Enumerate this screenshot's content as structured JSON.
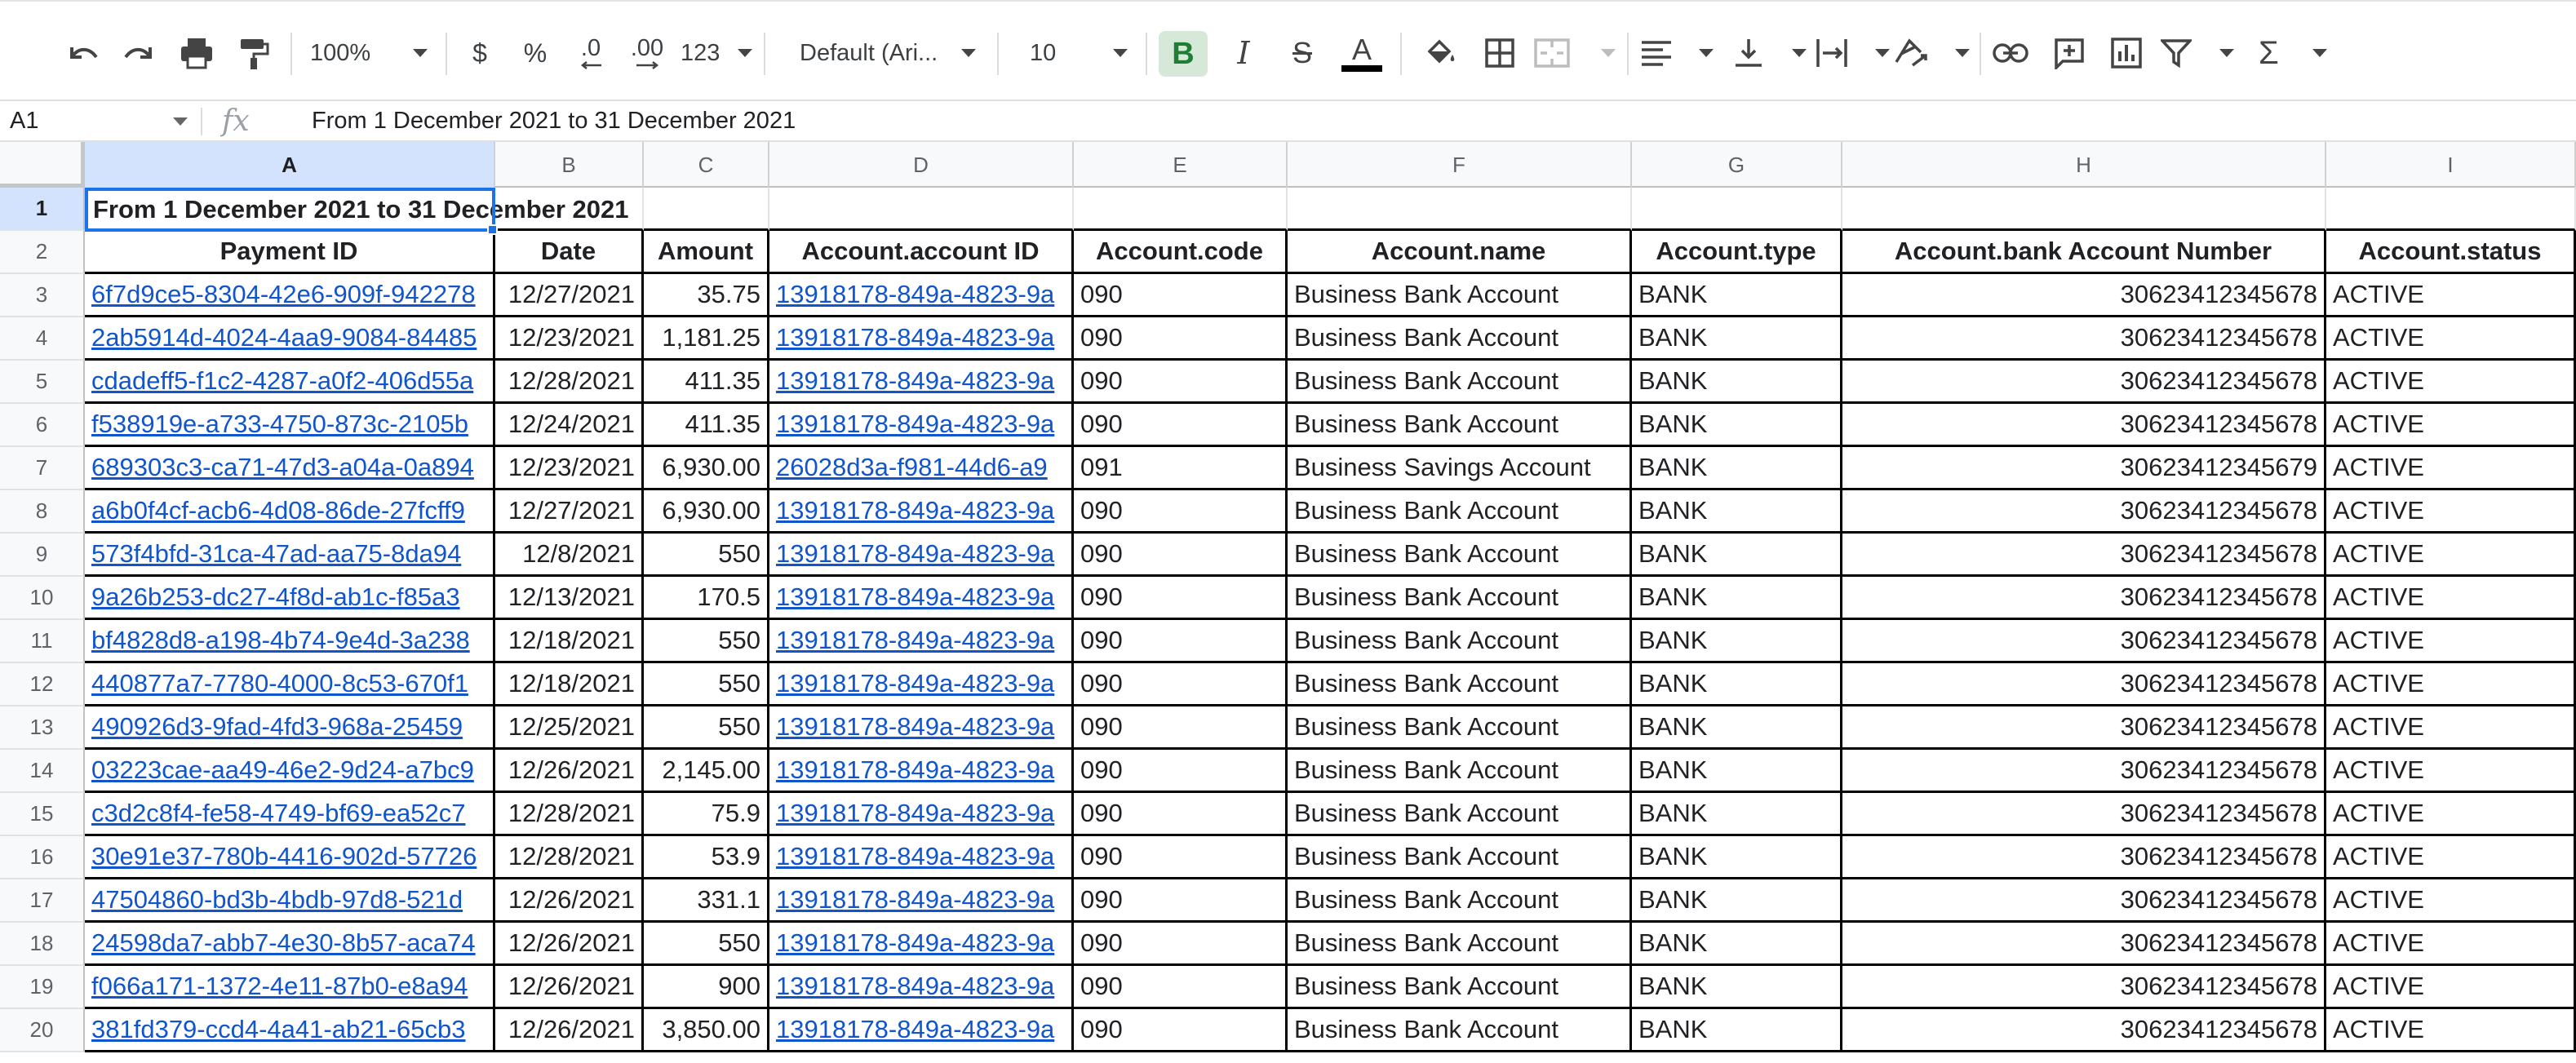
{
  "toolbar": {
    "zoom": "100%",
    "currency_symbol": "$",
    "percent_symbol": "%",
    "decrease_decimals": ".0",
    "increase_decimals": ".00",
    "more_formats": "123",
    "font": "Default (Ari...",
    "font_size": "10",
    "bold_label": "B",
    "italic_label": "I",
    "strike_label": "S",
    "text_color_label": "A",
    "accent_color": "#1a73e8",
    "link_color": "#1155cc",
    "bold_active_bg": "#d6e9d8"
  },
  "formula_bar": {
    "cell_ref": "A1",
    "fx_label": "fx",
    "content": "From 1 December 2021 to 31 December 2021"
  },
  "sheet": {
    "columns": [
      "A",
      "B",
      "C",
      "D",
      "E",
      "F",
      "G",
      "H",
      "I"
    ],
    "title": "From 1 December 2021 to 31 December 2021",
    "headers": [
      "Payment ID",
      "Date",
      "Amount",
      "Account.account ID",
      "Account.code",
      "Account.name",
      "Account.type",
      "Account.bank Account Number",
      "Account.status"
    ],
    "rows": [
      {
        "n": "3",
        "cells": [
          "6f7d9ce5-8304-42e6-909f-942278",
          "12/27/2021",
          "35.75",
          "13918178-849a-4823-9a",
          "090",
          "Business Bank Account",
          "BANK",
          "30623412345678",
          "ACTIVE"
        ]
      },
      {
        "n": "4",
        "cells": [
          "2ab5914d-4024-4aa9-9084-84485",
          "12/23/2021",
          "1,181.25",
          "13918178-849a-4823-9a",
          "090",
          "Business Bank Account",
          "BANK",
          "30623412345678",
          "ACTIVE"
        ]
      },
      {
        "n": "5",
        "cells": [
          "cdadeff5-f1c2-4287-a0f2-406d55a",
          "12/28/2021",
          "411.35",
          "13918178-849a-4823-9a",
          "090",
          "Business Bank Account",
          "BANK",
          "30623412345678",
          "ACTIVE"
        ]
      },
      {
        "n": "6",
        "cells": [
          "f538919e-a733-4750-873c-2105b",
          "12/24/2021",
          "411.35",
          "13918178-849a-4823-9a",
          "090",
          "Business Bank Account",
          "BANK",
          "30623412345678",
          "ACTIVE"
        ]
      },
      {
        "n": "7",
        "cells": [
          "689303c3-ca71-47d3-a04a-0a894",
          "12/23/2021",
          "6,930.00",
          "26028d3a-f981-44d6-a9",
          "091",
          "Business Savings Account",
          "BANK",
          "30623412345679",
          "ACTIVE"
        ]
      },
      {
        "n": "8",
        "cells": [
          "a6b0f4cf-acb6-4d08-86de-27fcff9",
          "12/27/2021",
          "6,930.00",
          "13918178-849a-4823-9a",
          "090",
          "Business Bank Account",
          "BANK",
          "30623412345678",
          "ACTIVE"
        ]
      },
      {
        "n": "9",
        "cells": [
          "573f4bfd-31ca-47ad-aa75-8da94",
          "12/8/2021",
          "550",
          "13918178-849a-4823-9a",
          "090",
          "Business Bank Account",
          "BANK",
          "30623412345678",
          "ACTIVE"
        ]
      },
      {
        "n": "10",
        "cells": [
          "9a26b253-dc27-4f8d-ab1c-f85a3",
          "12/13/2021",
          "170.5",
          "13918178-849a-4823-9a",
          "090",
          "Business Bank Account",
          "BANK",
          "30623412345678",
          "ACTIVE"
        ]
      },
      {
        "n": "11",
        "cells": [
          "bf4828d8-a198-4b74-9e4d-3a238",
          "12/18/2021",
          "550",
          "13918178-849a-4823-9a",
          "090",
          "Business Bank Account",
          "BANK",
          "30623412345678",
          "ACTIVE"
        ]
      },
      {
        "n": "12",
        "cells": [
          "440877a7-7780-4000-8c53-670f1",
          "12/18/2021",
          "550",
          "13918178-849a-4823-9a",
          "090",
          "Business Bank Account",
          "BANK",
          "30623412345678",
          "ACTIVE"
        ]
      },
      {
        "n": "13",
        "cells": [
          "490926d3-9fad-4fd3-968a-25459",
          "12/25/2021",
          "550",
          "13918178-849a-4823-9a",
          "090",
          "Business Bank Account",
          "BANK",
          "30623412345678",
          "ACTIVE"
        ]
      },
      {
        "n": "14",
        "cells": [
          "03223cae-aa49-46e2-9d24-a7bc9",
          "12/26/2021",
          "2,145.00",
          "13918178-849a-4823-9a",
          "090",
          "Business Bank Account",
          "BANK",
          "30623412345678",
          "ACTIVE"
        ]
      },
      {
        "n": "15",
        "cells": [
          "c3d2c8f4-fe58-4749-bf69-ea52c7",
          "12/28/2021",
          "75.9",
          "13918178-849a-4823-9a",
          "090",
          "Business Bank Account",
          "BANK",
          "30623412345678",
          "ACTIVE"
        ]
      },
      {
        "n": "16",
        "cells": [
          "30e91e37-780b-4416-902d-57726",
          "12/28/2021",
          "53.9",
          "13918178-849a-4823-9a",
          "090",
          "Business Bank Account",
          "BANK",
          "30623412345678",
          "ACTIVE"
        ]
      },
      {
        "n": "17",
        "cells": [
          "47504860-bd3b-4bdb-97d8-521d",
          "12/26/2021",
          "331.1",
          "13918178-849a-4823-9a",
          "090",
          "Business Bank Account",
          "BANK",
          "30623412345678",
          "ACTIVE"
        ]
      },
      {
        "n": "18",
        "cells": [
          "24598da7-abb7-4e30-8b57-aca74",
          "12/26/2021",
          "550",
          "13918178-849a-4823-9a",
          "090",
          "Business Bank Account",
          "BANK",
          "30623412345678",
          "ACTIVE"
        ]
      },
      {
        "n": "19",
        "cells": [
          "f066a171-1372-4e11-87b0-e8a94",
          "12/26/2021",
          "900",
          "13918178-849a-4823-9a",
          "090",
          "Business Bank Account",
          "BANK",
          "30623412345678",
          "ACTIVE"
        ]
      },
      {
        "n": "20",
        "cells": [
          "381fd379-ccd4-4a41-ab21-65cb3",
          "12/26/2021",
          "3,850.00",
          "13918178-849a-4823-9a",
          "090",
          "Business Bank Account",
          "BANK",
          "30623412345678",
          "ACTIVE"
        ]
      }
    ]
  }
}
